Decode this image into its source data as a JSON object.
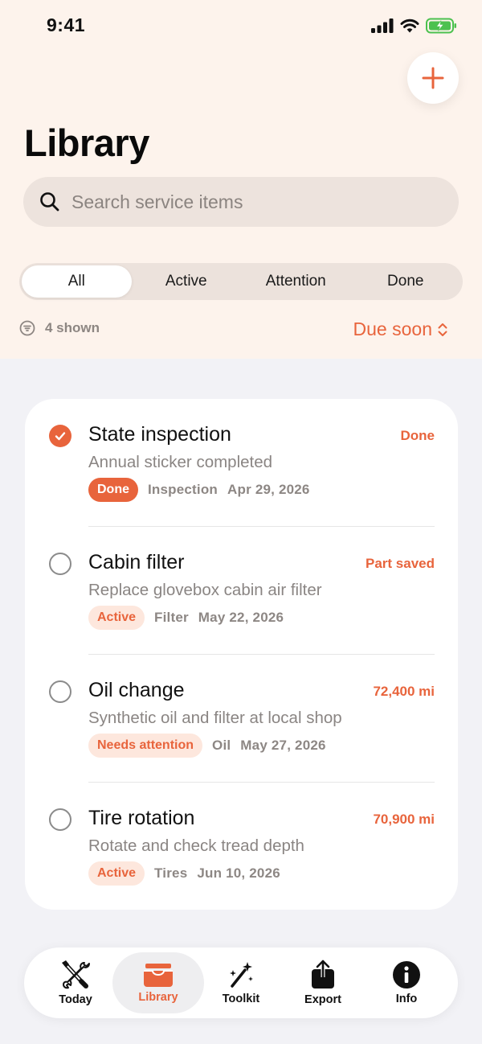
{
  "status_bar": {
    "time": "9:41"
  },
  "header": {
    "title": "Library",
    "add_button": "+"
  },
  "search": {
    "placeholder": "Search service items",
    "value": ""
  },
  "filters": [
    "All",
    "Active",
    "Attention",
    "Done"
  ],
  "selected_filter": "All",
  "summary": {
    "shown": "4 shown",
    "sort": "Due soon"
  },
  "items": [
    {
      "title": "State inspection",
      "subtitle": "Annual sticker completed",
      "right": "Done",
      "status": "Done",
      "category": "Inspection",
      "date": "Apr 29, 2026",
      "checked": true
    },
    {
      "title": "Cabin filter",
      "subtitle": "Replace glovebox cabin air filter",
      "right": "Part saved",
      "status": "Active",
      "category": "Filter",
      "date": "May 22, 2026",
      "checked": false
    },
    {
      "title": "Oil change",
      "subtitle": "Synthetic oil and filter at local shop",
      "right": "72,400 mi",
      "status": "Needs attention",
      "category": "Oil",
      "date": "May 27, 2026",
      "checked": false
    },
    {
      "title": "Tire rotation",
      "subtitle": "Rotate and check tread depth",
      "right": "70,900 mi",
      "status": "Active",
      "category": "Tires",
      "date": "Jun 10, 2026",
      "checked": false
    }
  ],
  "tabbar": {
    "tabs": [
      {
        "label": "Today",
        "icon": "tools-icon"
      },
      {
        "label": "Library",
        "icon": "tray-icon"
      },
      {
        "label": "Toolkit",
        "icon": "magic-wand-icon"
      },
      {
        "label": "Export",
        "icon": "share-icon"
      },
      {
        "label": "Info",
        "icon": "info-icon"
      }
    ],
    "selected": "Library"
  },
  "colors": {
    "accent": "#e8643c",
    "header_bg": "#fdf3ec",
    "page_bg": "#f2f2f6"
  }
}
